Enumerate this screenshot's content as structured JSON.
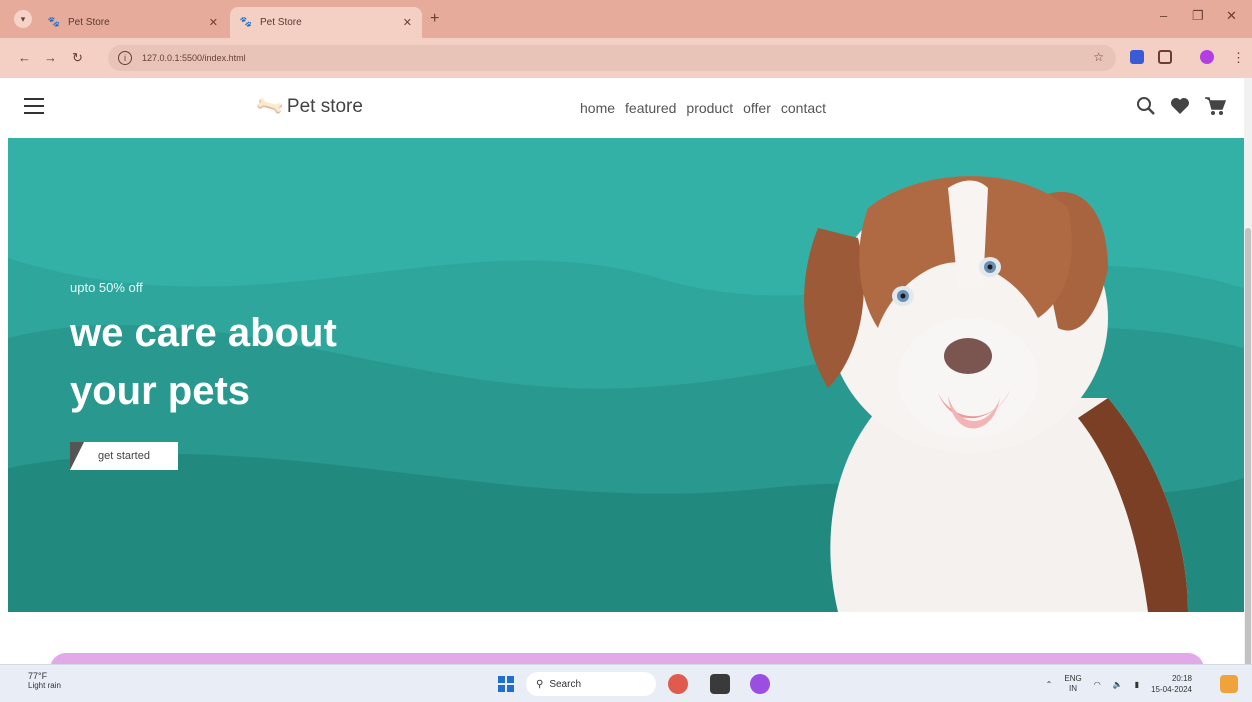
{
  "browser": {
    "tabs": [
      {
        "title": "Pet Store",
        "active": false
      },
      {
        "title": "Pet Store",
        "active": true
      }
    ],
    "url": "127.0.0.1:5500/index.html"
  },
  "site": {
    "logo_text": "Pet store",
    "nav": [
      "home",
      "featured",
      "product",
      "offer",
      "contact"
    ]
  },
  "hero": {
    "offer_text": "upto 50% off",
    "headline_line1": "we care about",
    "headline_line2": "your pets",
    "cta_label": "get started"
  },
  "taskbar": {
    "weather_temp": "77°F",
    "weather_desc": "Light rain",
    "search_placeholder": "Search",
    "language": "ENG",
    "language_region": "IN",
    "time": "20:18",
    "date": "15-04-2024"
  },
  "colors": {
    "hero_bg": "#2fa69c",
    "brand_accent": "#2ba89c",
    "tab_bar": "#e6ab9b",
    "promo_strip": "#e2a9e8"
  }
}
